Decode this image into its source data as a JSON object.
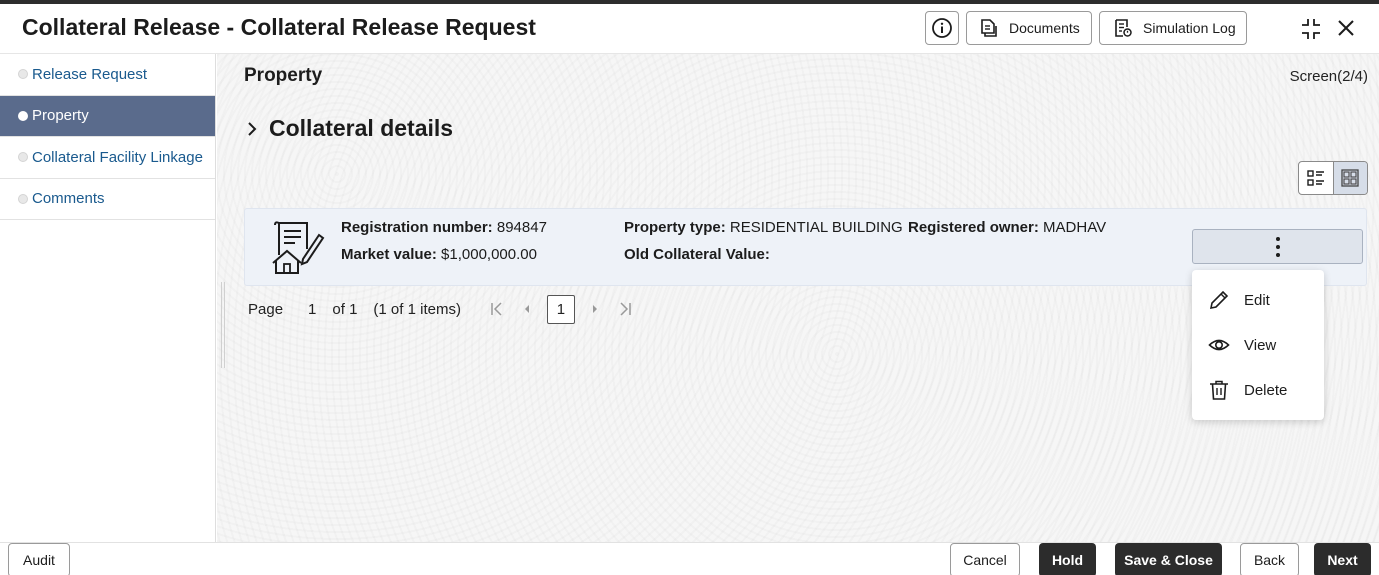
{
  "header": {
    "title": "Collateral Release - Collateral Release Request",
    "documents_label": "Documents",
    "simulation_log_label": "Simulation Log"
  },
  "sidebar": {
    "items": [
      {
        "label": "Release Request",
        "active": false
      },
      {
        "label": "Property",
        "active": true
      },
      {
        "label": "Collateral Facility Linkage",
        "active": false
      },
      {
        "label": "Comments",
        "active": false
      }
    ]
  },
  "main": {
    "section_title": "Property",
    "screen_indicator": "Screen(2/4)",
    "collateral_title": "Collateral details",
    "card": {
      "registration_number_label": "Registration number:",
      "registration_number": "894847",
      "property_type_label": "Property type:",
      "property_type": "RESIDENTIAL BUILDING",
      "registered_owner_label": "Registered owner:",
      "registered_owner": "MADHAV",
      "market_value_label": "Market value:",
      "market_value": "$1,000,000.00",
      "old_collateral_value_label": "Old Collateral Value:",
      "old_collateral_value": ""
    },
    "pager": {
      "page_label": "Page",
      "page_number": "1",
      "of_label": "of 1",
      "items_label": "(1 of 1 items)",
      "current_page": "1"
    },
    "actions_menu": {
      "items": [
        {
          "label": "Edit",
          "icon": "pencil-icon"
        },
        {
          "label": "View",
          "icon": "eye-icon"
        },
        {
          "label": "Delete",
          "icon": "trash-icon"
        }
      ]
    }
  },
  "footer": {
    "audit_label": "Audit",
    "cancel_label": "Cancel",
    "hold_label": "Hold",
    "save_close_label": "Save & Close",
    "back_label": "Back",
    "next_label": "Next"
  },
  "colors": {
    "sidebar_active_bg": "#5a6b8c",
    "sidebar_link": "#1a5a8e",
    "card_bg": "#eef2f8",
    "primary_button": "#2c2c2c"
  }
}
